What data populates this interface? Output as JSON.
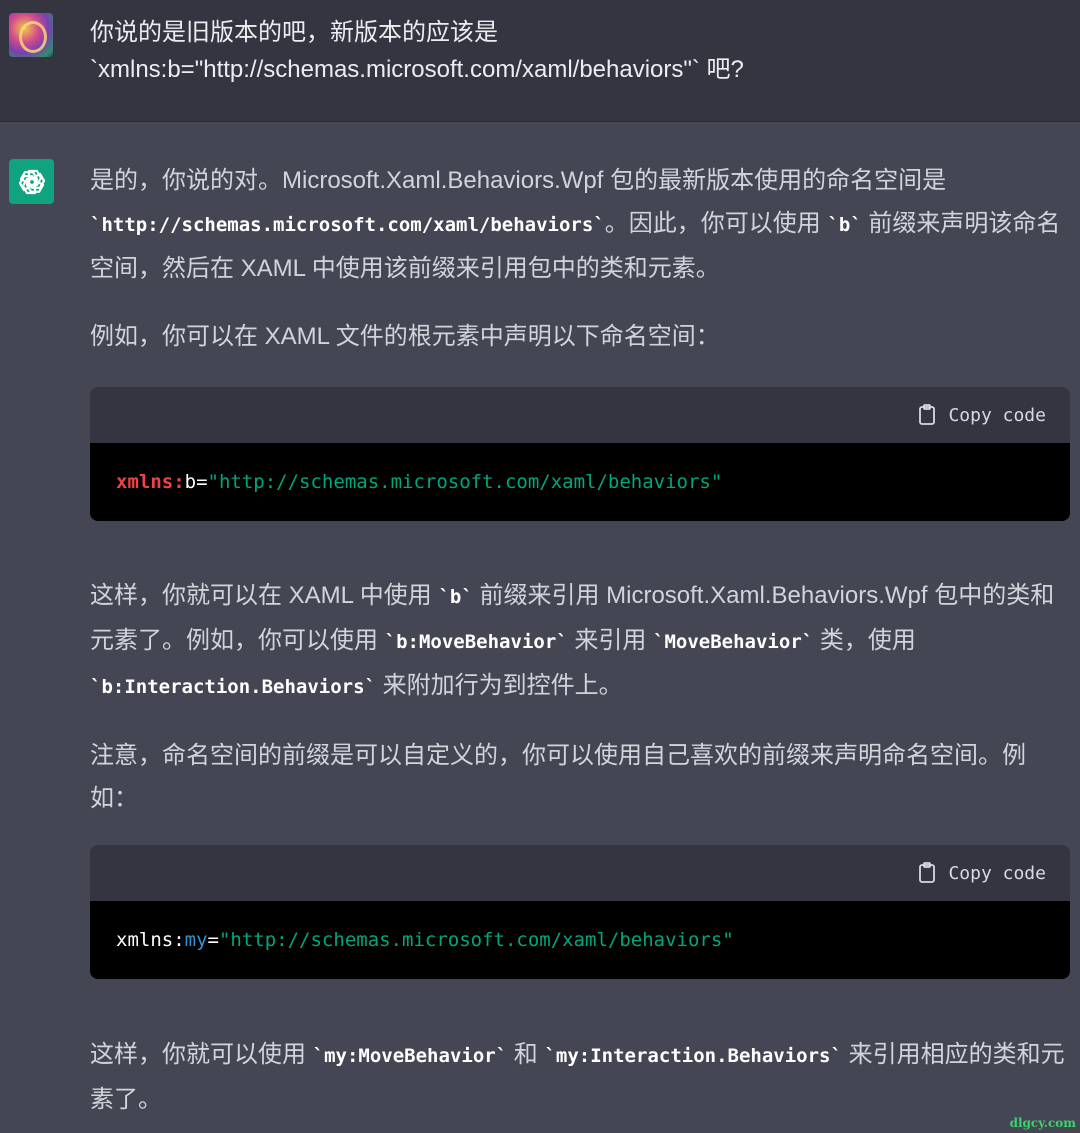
{
  "user_message": {
    "line1": "你说的是旧版本的吧，新版本的应该是",
    "line2": "`xmlns:b=\"http://schemas.microsoft.com/xaml/behaviors\"` 吧?"
  },
  "assistant": {
    "p1": {
      "t1": "是的，你说的对。Microsoft.Xaml.Behaviors.Wpf 包的最新版本使用的命名空间是",
      "c1": "`http://schemas.microsoft.com/xaml/behaviors`",
      "t2": "。因此，你可以使用 ",
      "c2": "`b`",
      "t3": " 前缀来声明该命名空间，然后在 XAML 中使用该前缀来引用包中的类和元素。"
    },
    "p2": "例如，你可以在 XAML 文件的根元素中声明以下命名空间：",
    "code1": {
      "copy_label": "Copy code",
      "attr": "xmlns:",
      "name": "b",
      "eq": "=",
      "value": "\"http://schemas.microsoft.com/xaml/behaviors\""
    },
    "p3": {
      "t1": "这样，你就可以在 XAML 中使用 ",
      "c1": "`b`",
      "t2": " 前缀来引用 Microsoft.Xaml.Behaviors.Wpf 包中的类和元素了。例如，你可以使用 ",
      "c2": "`b:MoveBehavior`",
      "t3": " 来引用 ",
      "c3": "`MoveBehavior`",
      "t4": " 类，使用 ",
      "c4": "`b:Interaction.Behaviors`",
      "t5": " 来附加行为到控件上。"
    },
    "p4": "注意，命名空间的前缀是可以自定义的，你可以使用自己喜欢的前缀来声明命名空间。例如：",
    "code2": {
      "copy_label": "Copy code",
      "attr": "xmlns:",
      "name": "my",
      "eq": "=",
      "value": "\"http://schemas.microsoft.com/xaml/behaviors\""
    },
    "p5": {
      "t1": "这样，你就可以使用 ",
      "c1": "`my:MoveBehavior`",
      "t2": " 和 ",
      "c2": "`my:Interaction.Behaviors`",
      "t3": " 来引用相应的类和元素了。"
    }
  },
  "watermark": "dlgcy.com",
  "colors": {
    "user_bg": "#343541",
    "assistant_bg": "#444654",
    "code_header_bg": "#343541",
    "code_body_bg": "#000000",
    "brand_green": "#10a37f",
    "token_red": "#ef4146",
    "token_green": "#00a67d",
    "token_blue": "#2e95d3"
  },
  "icons": {
    "assistant_avatar": "openai-logo-icon",
    "copy": "clipboard-icon"
  }
}
